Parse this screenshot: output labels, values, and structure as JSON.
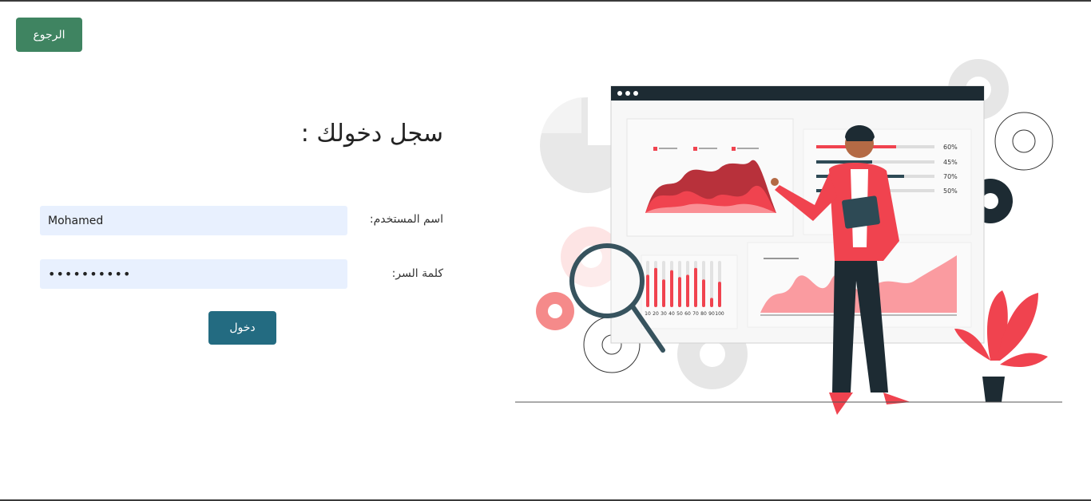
{
  "header": {
    "back_label": "الرجوع"
  },
  "login": {
    "title": "سجل دخولك :",
    "username_label": "اسم المستخدم:",
    "username_value": "Mohamed",
    "password_label": "كلمة السر:",
    "password_value": "••••••••••",
    "submit_label": "دخول"
  },
  "illustration": {
    "stats": [
      "60%",
      "45%",
      "70%",
      "50%"
    ],
    "bar_axis": [
      "10",
      "20",
      "30",
      "40",
      "50",
      "60",
      "70",
      "80",
      "90",
      "100"
    ]
  },
  "colors": {
    "back_button": "#3f8461",
    "login_button": "#236b81",
    "input_bg": "#e8f0fe",
    "accent_red": "#f0434f",
    "dark_navy": "#1d2b33"
  }
}
